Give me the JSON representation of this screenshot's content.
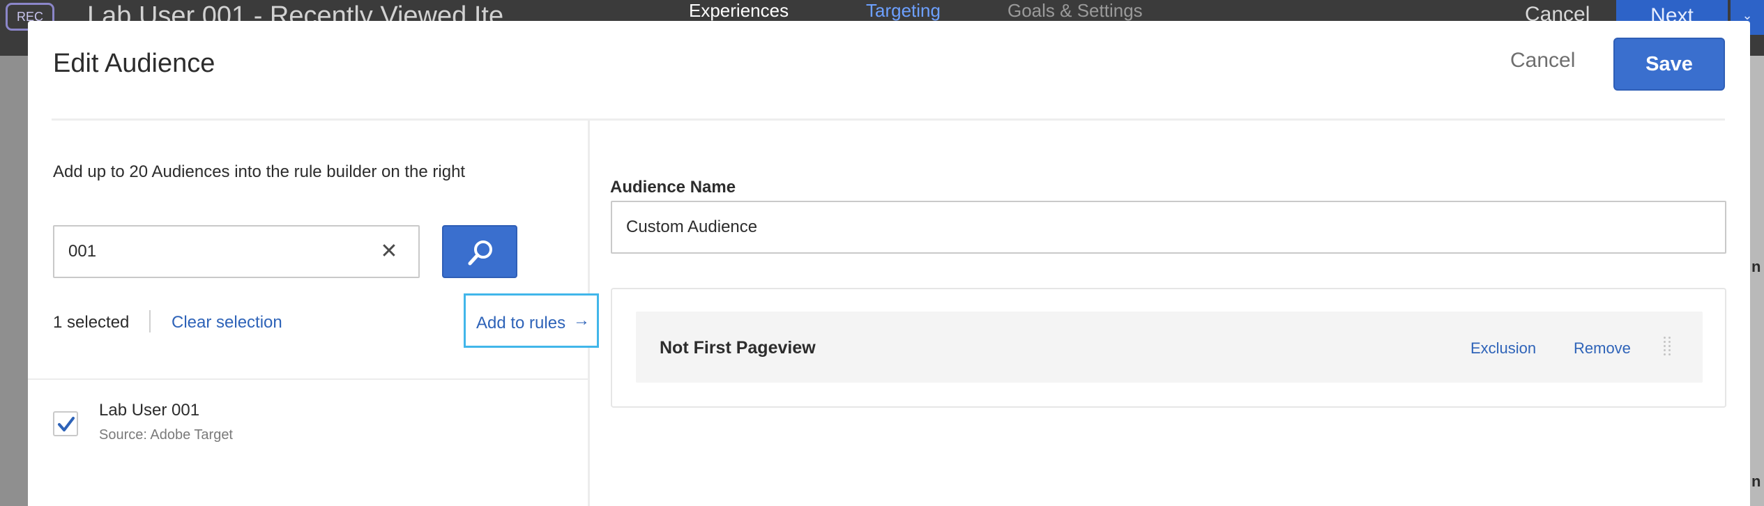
{
  "background": {
    "rec_badge": "REC",
    "activity_title": "Lab User 001 - Recently Viewed Ite",
    "tabs": [
      {
        "label": "Experiences"
      },
      {
        "label": "Targeting"
      },
      {
        "label": "Goals & Settings"
      }
    ],
    "cancel_label": "Cancel",
    "next_label": "Next",
    "side_letters": [
      "n",
      "n"
    ]
  },
  "modal": {
    "title": "Edit Audience",
    "cancel_label": "Cancel",
    "save_label": "Save"
  },
  "left_panel": {
    "instruction": "Add up to 20 Audiences into the rule builder on the right",
    "search": {
      "value": "001",
      "placeholder": ""
    },
    "selected_count": "1 selected",
    "clear_selection": "Clear selection",
    "add_to_rules": "Add to rules",
    "results": [
      {
        "title": "Lab User 001",
        "source": "Source: Adobe Target",
        "checked": true
      }
    ]
  },
  "right_panel": {
    "audience_name_label": "Audience Name",
    "audience_name_value": "Custom Audience",
    "rules": [
      {
        "name": "Not First Pageview",
        "exclusion_label": "Exclusion",
        "remove_label": "Remove"
      }
    ]
  },
  "colors": {
    "accent": "#3a6fce",
    "link": "#2e63b8",
    "focus": "#41b6ea",
    "topbar": "#3b3b3b"
  }
}
